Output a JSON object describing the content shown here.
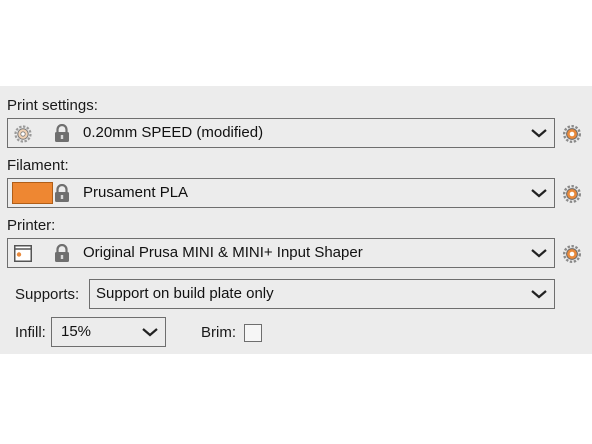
{
  "print_settings": {
    "label": "Print settings:",
    "value": "0.20mm SPEED (modified)",
    "icons": [
      "gear-icon",
      "lock-icon",
      "chevron-down-icon",
      "gear-icon"
    ]
  },
  "filament": {
    "label": "Filament:",
    "value": "Prusament PLA",
    "color": "#ee8732",
    "icons": [
      "color-swatch",
      "lock-icon",
      "chevron-down-icon",
      "gear-icon"
    ]
  },
  "printer": {
    "label": "Printer:",
    "value": "Original Prusa MINI & MINI+ Input Shaper",
    "icons": [
      "printer-icon",
      "lock-icon",
      "chevron-down-icon",
      "gear-icon"
    ]
  },
  "supports": {
    "label": "Supports:",
    "value": "Support on build plate only"
  },
  "infill": {
    "label": "Infill:",
    "value": "15%"
  },
  "brim": {
    "label": "Brim:",
    "checked": false
  },
  "colors": {
    "panel_bg": "#ececec",
    "gear_orange": "#e98a3c",
    "filament_swatch": "#ee8732"
  }
}
